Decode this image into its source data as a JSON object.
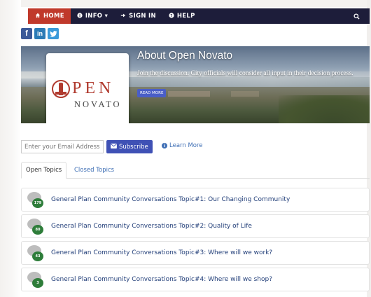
{
  "nav": {
    "items": [
      {
        "icon": "home-icon",
        "glyph": "⌂",
        "label": "HOME"
      },
      {
        "icon": "info-icon",
        "glyph": "ℹ",
        "label": "INFO ▾"
      },
      {
        "icon": "sign-in-icon",
        "glyph": "➔",
        "label": "SIGN IN"
      },
      {
        "icon": "help-icon",
        "glyph": "?",
        "label": "HELP"
      }
    ],
    "search_icon": "search-icon"
  },
  "social": {
    "facebook": "f",
    "linkedin": "in",
    "twitter": "t"
  },
  "hero": {
    "title": "About Open Novato",
    "text": "Join the discussion. City officials will consider all input in their decision process.",
    "read_more": "READ MORE",
    "logo_word": "PEN",
    "logo_sub": "NOVATO"
  },
  "subscribe": {
    "placeholder": "Enter your Email Address",
    "button": "Subscribe",
    "learn_more": "Learn More"
  },
  "tabs": {
    "open": "Open Topics",
    "closed": "Closed Topics"
  },
  "topics": [
    {
      "count": "179",
      "title": "General Plan Community Conversations Topic#1: Our Changing Community"
    },
    {
      "count": "80",
      "title": "General Plan Community Conversations Topic#2: Quality of Life"
    },
    {
      "count": "43",
      "title": "General Plan Community Conversations Topic#3: Where will we work?"
    },
    {
      "count": "3",
      "title": "General Plan Community Conversations Topic#4: Where will we shop?"
    }
  ],
  "colors": {
    "nav_bg": "#1d1d3a",
    "nav_active": "#c0392b",
    "accent": "#3f51b5",
    "badge": "#2e7d3a"
  }
}
